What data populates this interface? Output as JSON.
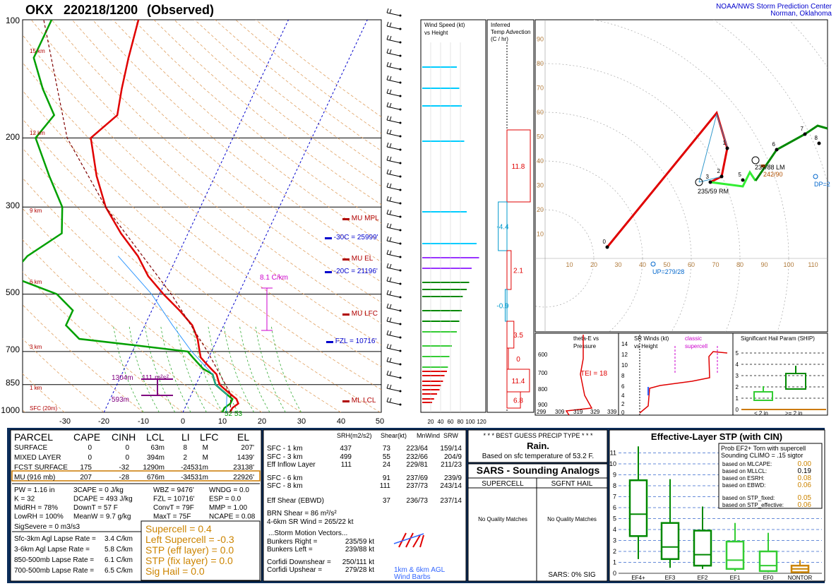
{
  "header": {
    "station": "OKX",
    "datetime": "220218/1200",
    "status": "(Observed)",
    "org1": "NOAA/NWS Storm Prediction Center",
    "org2": "Norman, Oklahoma"
  },
  "skewt": {
    "p_ticks": [
      "100",
      "200",
      "300",
      "500",
      "700",
      "850",
      "1000"
    ],
    "t_ticks": [
      "-30",
      "-20",
      "-10",
      "0",
      "10",
      "20",
      "30",
      "40",
      "50"
    ],
    "heights": [
      "15 km",
      "12 km",
      "9 km",
      "6 km",
      "3 km",
      "1 km",
      "SFC (20m)"
    ],
    "levels": [
      {
        "label": "MU MPL",
        "color": "#b00000"
      },
      {
        "label": "-30C = 25999'",
        "color": "#0000cc"
      },
      {
        "label": "MU EL",
        "color": "#b00000"
      },
      {
        "label": "-20C = 21196'",
        "color": "#0000cc"
      },
      {
        "label": "MU LFC",
        "color": "#b00000"
      },
      {
        "label": "FZL = 10716'",
        "color": "#0000cc"
      },
      {
        "label": "ML LCL",
        "color": "#b00000"
      }
    ],
    "lapse_label": "8.1 C/km",
    "srh_label": "111 m²s²",
    "srh_top": "1304m",
    "srh_bot": "593m",
    "sfc_temps": "52 53"
  },
  "chart_data": [
    {
      "type": "line",
      "title": "",
      "yscale": "log-pressure",
      "ylim": [
        1000,
        100
      ],
      "xlim": [
        -30,
        50
      ],
      "series": [
        {
          "name": "Temperature",
          "color": "#e00000",
          "points": [
            [
              1000,
              12
            ],
            [
              975,
              12
            ],
            [
              950,
              13
            ],
            [
              925,
              12
            ],
            [
              900,
              10
            ],
            [
              875,
              8
            ],
            [
              850,
              6
            ],
            [
              825,
              5
            ],
            [
              800,
              4
            ],
            [
              775,
              2
            ],
            [
              750,
              0
            ],
            [
              725,
              -2
            ],
            [
              700,
              -3
            ],
            [
              650,
              -5
            ],
            [
              600,
              -8
            ],
            [
              550,
              -13
            ],
            [
              500,
              -19
            ],
            [
              450,
              -25
            ],
            [
              400,
              -30
            ],
            [
              350,
              -37
            ],
            [
              300,
              -44
            ],
            [
              250,
              -50
            ],
            [
              200,
              -56
            ],
            [
              175,
              -52
            ],
            [
              150,
              -54
            ],
            [
              125,
              -56
            ],
            [
              100,
              -58
            ]
          ]
        },
        {
          "name": "Dewpoint",
          "color": "#00a000",
          "points": [
            [
              1000,
              10
            ],
            [
              975,
              10
            ],
            [
              950,
              11
            ],
            [
              925,
              11
            ],
            [
              900,
              9
            ],
            [
              875,
              7
            ],
            [
              850,
              5
            ],
            [
              825,
              4
            ],
            [
              800,
              3
            ],
            [
              775,
              0
            ],
            [
              750,
              -2
            ],
            [
              725,
              -4
            ],
            [
              700,
              -6
            ],
            [
              675,
              -20
            ],
            [
              650,
              -35
            ],
            [
              600,
              -40
            ],
            [
              550,
              -40
            ],
            [
              500,
              -46
            ],
            [
              450,
              -60
            ],
            [
              400,
              -58
            ],
            [
              350,
              -52
            ],
            [
              300,
              -55
            ],
            [
              250,
              -62
            ],
            [
              200,
              -70
            ],
            [
              175,
              -68
            ],
            [
              150,
              -74
            ],
            [
              125,
              -80
            ],
            [
              100,
              -80
            ]
          ]
        }
      ]
    },
    {
      "type": "bar",
      "title": "Wind Speed (kt) vs Height",
      "xlabel": "",
      "x_ticks": [
        "20",
        "40",
        "60",
        "80",
        "100",
        "120"
      ],
      "values_kt": [
        20,
        24,
        30,
        35,
        38,
        42,
        45,
        50,
        52,
        55,
        60,
        70,
        75,
        80,
        82,
        90,
        95,
        100,
        115,
        110,
        90,
        85,
        80,
        75,
        70
      ]
    },
    {
      "type": "bar",
      "title": "Inferred Temp Advection (C / hr)",
      "values": [
        11.8,
        -4.4,
        2.1,
        -0.9,
        3.5,
        -0.0,
        11.4,
        6.8
      ]
    },
    {
      "type": "line",
      "title": "Hodograph",
      "xlim": [
        0,
        110
      ],
      "ylim": [
        0,
        110
      ],
      "ticks": [
        "10",
        "20",
        "30",
        "40",
        "50",
        "60",
        "70",
        "80",
        "90",
        "100",
        "110"
      ],
      "labels": [
        "0",
        "1",
        "2",
        "3",
        "5",
        "6",
        "7",
        "8"
      ],
      "storm_rm": "235/59 RM",
      "storm_lm": "239/88 LM",
      "mean": "242/90",
      "up": "UP=279/28",
      "dp": "DP=2"
    },
    {
      "type": "line",
      "title": "theta-E vs Pressure",
      "x_ticks": [
        "299",
        "309",
        "319",
        "329",
        "339"
      ],
      "y_ticks": [
        "600",
        "700",
        "800",
        "900"
      ],
      "tei": "TEI = 18"
    },
    {
      "type": "line",
      "title": "SR Winds (kt) vs Height",
      "y_ticks": [
        "0",
        "2",
        "4",
        "6",
        "8",
        "10",
        "12",
        "14"
      ],
      "annot": "classic supercell"
    },
    {
      "type": "bar",
      "title": "Significant Hail Param (SHIP)",
      "y_ticks": [
        "0",
        "1",
        "2",
        "3",
        "4",
        "5"
      ],
      "x_labels": [
        "< 2 in",
        ">= 2 in"
      ]
    }
  ],
  "parcel": {
    "headers": [
      "PARCEL",
      "CAPE",
      "CINH",
      "LCL",
      "LI",
      "LFC",
      "EL"
    ],
    "rows": [
      [
        "SURFACE",
        "0",
        "0",
        "63m",
        "8",
        "M",
        "207'"
      ],
      [
        "MIXED LAYER",
        "0",
        "0",
        "394m",
        "2",
        "M",
        "1439'"
      ],
      [
        "FCST SURFACE",
        "175",
        "-32",
        "1290m",
        "-2",
        "4531m",
        "23138'"
      ],
      [
        "MU   (916 mb)",
        "207",
        "-28",
        "676m",
        "-3",
        "4531m",
        "22926'"
      ]
    ],
    "misc": [
      [
        "PW = 1.16 in",
        "3CAPE = 0 J/kg",
        "WBZ = 9476'",
        "WNDG = 0.0"
      ],
      [
        "K = 32",
        "DCAPE = 493 J/kg",
        "FZL = 10716'",
        "ESP = 0.0"
      ],
      [
        "MidRH = 78%",
        "DownT = 57 F",
        "ConvT = 79F",
        "MMP = 1.00"
      ],
      [
        "LowRH = 100%",
        "MeanW = 9.7 g/kg",
        "MaxT = 75F",
        "NCAPE = 0.08"
      ]
    ],
    "sigsevere": "SigSevere = 0 m3/s3",
    "lapse": [
      [
        "Sfc-3km Agl Lapse Rate =",
        "3.4 C/km"
      ],
      [
        "3-6km Agl Lapse Rate =",
        "5.8 C/km"
      ],
      [
        "850-500mb Lapse Rate =",
        "6.1 C/km"
      ],
      [
        "700-500mb Lapse Rate =",
        "6.5 C/km"
      ]
    ],
    "composite": [
      "Supercell = 0.4",
      "Left Supercell = -0.3",
      "STP (eff layer) = 0.0",
      "STP (fix layer) = 0.0",
      "Sig Hail = 0.0"
    ]
  },
  "kinematics": {
    "headers": [
      "SRH(m2/s2)",
      "Shear(kt)",
      "MnWind",
      "SRW"
    ],
    "rows": [
      [
        "SFC - 1 km",
        "437",
        "73",
        "223/64",
        "159/14"
      ],
      [
        "SFC - 3 km",
        "499",
        "55",
        "232/66",
        "204/9"
      ],
      [
        "Eff Inflow Layer",
        "111",
        "24",
        "229/81",
        "211/23"
      ],
      [
        "SFC - 6 km",
        "91",
        "237/69",
        "239/9"
      ],
      [
        "SFC - 8 km",
        "111",
        "237/73",
        "243/14"
      ],
      [
        "Eff Shear (EBWD)",
        "37",
        "236/73",
        "237/14"
      ]
    ],
    "brn": "BRN Shear =  86 m²/s²",
    "srw46": "4-6km SR Wind =      265/22 kt",
    "smv_title": "...Storm Motion Vectors...",
    "smv": [
      [
        "Bunkers Right =",
        "235/59 kt"
      ],
      [
        "Bunkers Left =",
        "239/88 kt"
      ],
      [
        "Corfidi Downshear =",
        "250/111 kt"
      ],
      [
        "Corfidi Upshear =",
        "279/28 kt"
      ]
    ],
    "barb_note1": "1km & 6km AGL",
    "barb_note2": "Wind Barbs"
  },
  "precip": {
    "title": "* * * BEST GUESS PRECIP TYPE * * *",
    "type": "Rain.",
    "basis": "Based on sfc temperature of 53.2 F."
  },
  "sars": {
    "title": "SARS - Sounding Analogs",
    "col1": "SUPERCELL",
    "col2": "SGFNT HAIL",
    "nm1": "No Quality Matches",
    "nm2": "No Quality Matches",
    "sig": "SARS:  0% SIG"
  },
  "stp": {
    "title": "Effective-Layer STP (with CIN)",
    "prob_title1": "Prob EF2+ Torn with supercell",
    "prob_title2": "Sounding CLIMO = .15 sigtor",
    "probs": [
      [
        "based on MLCAPE:",
        "0.00"
      ],
      [
        "based on MLLCL:",
        "0.19"
      ],
      [
        "based on ESRH:",
        "0.08"
      ],
      [
        "based on EBWD:",
        "0.06"
      ],
      [
        "based on STP_fixed:",
        "0.05"
      ],
      [
        "based on STP_effective:",
        "0.06"
      ]
    ],
    "y_ticks": [
      "0",
      "1",
      "2",
      "3",
      "4",
      "5",
      "6",
      "7",
      "8",
      "9",
      "10",
      "11"
    ],
    "categories": [
      "EF4+",
      "EF3",
      "EF2",
      "EF1",
      "EF0",
      "NONTOR"
    ]
  }
}
